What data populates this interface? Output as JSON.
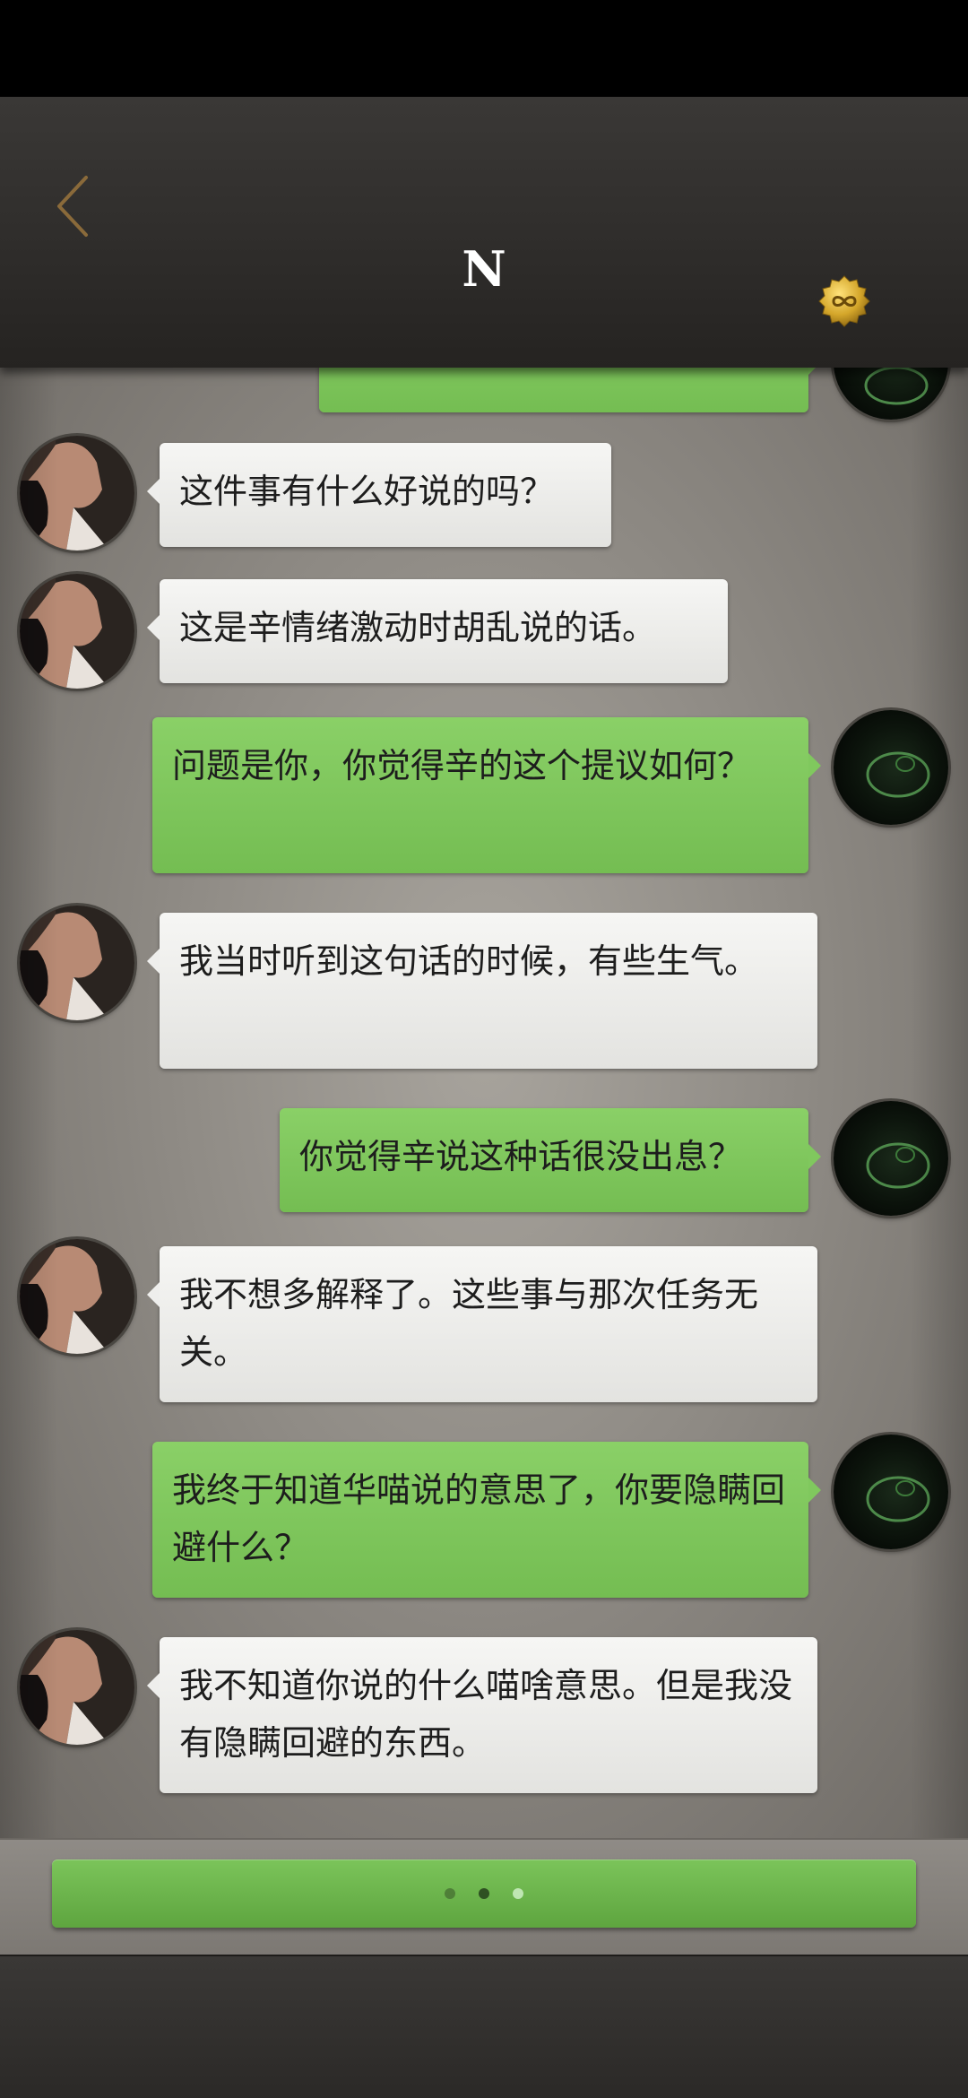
{
  "header": {
    "title": "N",
    "back_icon": "chevron-left-icon",
    "coin_icon": "coin-infinity-icon",
    "back_color": "#8a6a3a",
    "coin_color": "#d4a62a"
  },
  "messages": [
    {
      "side": "out",
      "text": ""
    },
    {
      "side": "in",
      "text": "这件事有什么好说的吗？"
    },
    {
      "side": "in",
      "text": "这是辛情绪激动时胡乱说的话。"
    },
    {
      "side": "out",
      "text": "问题是你，你觉得辛的这个提议如何？"
    },
    {
      "side": "in",
      "text": "我当时听到这句话的时候，有些生气。"
    },
    {
      "side": "out",
      "text": "你觉得辛说这种话很没出息？"
    },
    {
      "side": "in",
      "text": "我不想多解释了。这些事与那次任务无关。"
    },
    {
      "side": "out",
      "text": "我终于知道华喵说的意思了，你要隐瞒回避什么？"
    },
    {
      "side": "in",
      "text": "我不知道你说的什么喵啥意思。但是我没有隐瞒回避的东西。"
    }
  ],
  "continue_bar": {
    "dots": 3
  },
  "colors": {
    "incoming_bubble": "#eeeeec",
    "outgoing_bubble": "#80c85e",
    "accent_green": "#6cb84b"
  }
}
